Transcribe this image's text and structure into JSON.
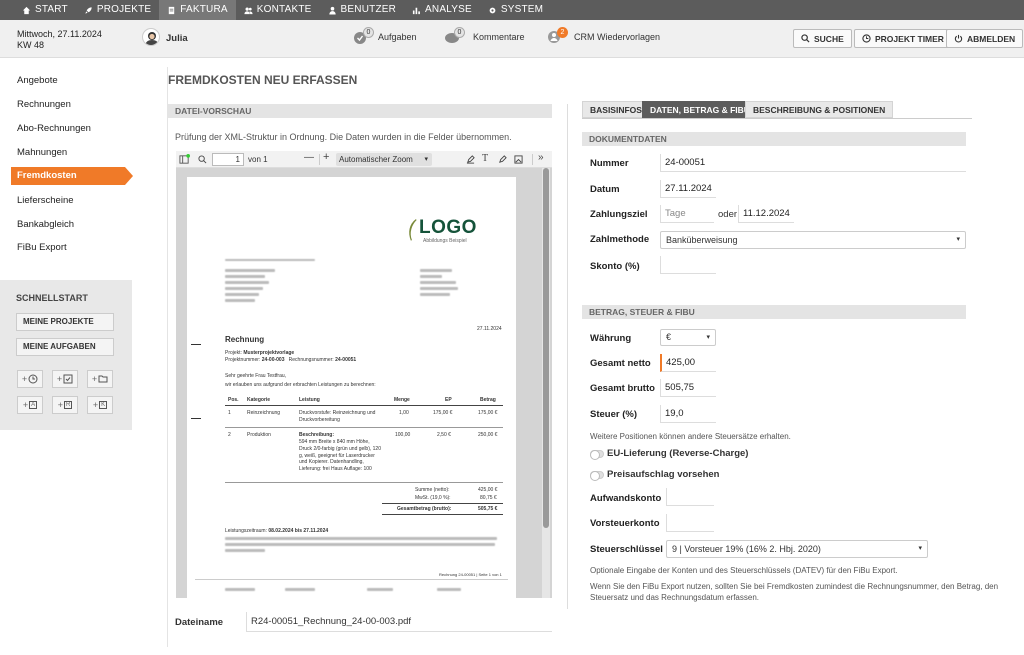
{
  "nav": {
    "items": [
      {
        "label": "START"
      },
      {
        "label": "PROJEKTE"
      },
      {
        "label": "FAKTURA"
      },
      {
        "label": "KONTAKTE"
      },
      {
        "label": "BENUTZER"
      },
      {
        "label": "ANALYSE"
      },
      {
        "label": "SYSTEM"
      }
    ]
  },
  "header": {
    "date": "Mittwoch, 27.11.2024",
    "week": "KW 48",
    "user": "Julia",
    "tasks_count": "0",
    "tasks_label": "Aufgaben",
    "comments_count": "0",
    "comments_label": "Kommentare",
    "crm_count": "2",
    "crm_label": "CRM Wiedervorlagen",
    "search_label": "SUCHE",
    "timer_label": "PROJEKT TIMER",
    "logout_label": "ABMELDEN"
  },
  "sidebar": {
    "items": [
      {
        "label": "Angebote"
      },
      {
        "label": "Rechnungen"
      },
      {
        "label": "Abo-Rechnungen"
      },
      {
        "label": "Mahnungen"
      },
      {
        "label": "Fremdkosten"
      },
      {
        "label": "Lieferscheine"
      },
      {
        "label": "Bankabgleich"
      },
      {
        "label": "FiBu Export"
      }
    ],
    "quickstart_title": "SCHNELLSTART",
    "quick_buttons": [
      "MEINE PROJEKTE",
      "MEINE AUFGABEN"
    ],
    "quick_icons": [
      "A",
      "R",
      "K"
    ]
  },
  "page": {
    "title": "FREMDKOSTEN NEU ERFASSEN",
    "preview_title": "DATEI-VORSCHAU",
    "preview_msg": "Prüfung der XML-Struktur in Ordnung. Die Daten wurden in die Felder übernommen.",
    "filename_label": "Dateiname",
    "filename": "R24-00051_Rechnung_24-00-003.pdf"
  },
  "pdf": {
    "page_num": "1",
    "page_of": "von 1",
    "zoom": "Automatischer Zoom",
    "logo": "LOGO",
    "logo_sub": "Abbildungs Beispiel",
    "date": "27.11.2024",
    "heading": "Rechnung",
    "project_line": "Projekt:",
    "project": "Musterprojektvorlage",
    "projnr_label": "Projektnummer:",
    "projnr": "24-00-003",
    "rechnr_label": "Rechnungsnummer:",
    "rechnr": "24-00051",
    "greeting": "Sehr geehrte Frau Testfrau,",
    "intro": "wir erlauben uns aufgrund der erbrachten Leistungen zu berechnen:",
    "cols": [
      "Pos.",
      "Kategorie",
      "Leistung",
      "Menge",
      "EP",
      "Betrag"
    ],
    "rows": [
      {
        "pos": "1",
        "kat": "Reinzeichnung",
        "leist": "Druckvorstufe: Reinzeichnung und",
        "leist2": "Druckvorbereitung",
        "menge": "1,00",
        "ep": "175,00 €",
        "betrag": "175,00 €"
      },
      {
        "pos": "2",
        "kat": "Produktion",
        "leist": "Beschreibung:",
        "leist2": "594 mm Breite x 840 mm Höhe, Druck 2/0-farbig (grün und gelb), 120 g, weiß, geeignet für Laserdrucker und Kopierer. Datenhandling, Lieferung: frei Haus Auflage: 100",
        "menge": "100,00",
        "ep": "2,50 €",
        "betrag": "250,00 €"
      }
    ],
    "summe_label": "Summe (netto):",
    "summe": "425,00 €",
    "mwst_label": "MwSt. (19,0 %):",
    "mwst": "80,75 €",
    "gesamt_label": "Gesamtbetrag (brutto):",
    "gesamt": "505,75 €",
    "zeitraum_label": "Leistungszeitraum:",
    "zeitraum": "08.02.2024 bis 27.11.2024",
    "footer_page": "Rechnung 24-00051 | Seite 1 von 1"
  },
  "form": {
    "tabs": [
      "BASISINFOS",
      "DATEN, BETRAG & FIBU",
      "BESCHREIBUNG & POSITIONEN"
    ],
    "section1": "DOKUMENTDATEN",
    "nummer_label": "Nummer",
    "nummer": "24-00051",
    "datum_label": "Datum",
    "datum": "27.11.2024",
    "ziel_label": "Zahlungsziel",
    "ziel_placeholder": "Tage",
    "oder": "oder",
    "ziel_date": "11.12.2024",
    "methode_label": "Zahlmethode",
    "methode": "Banküberweisung",
    "skonto_label": "Skonto (%)",
    "section2": "BETRAG, STEUER & FIBU",
    "waehrung_label": "Währung",
    "waehrung": "€",
    "netto_label": "Gesamt netto",
    "netto": "425,00",
    "brutto_label": "Gesamt brutto",
    "brutto": "505,75",
    "steuer_label": "Steuer (%)",
    "steuer": "19,0",
    "steuer_note": "Weitere Positionen können andere Steuersätze erhalten.",
    "eu_label": "EU-Lieferung (Reverse-Charge)",
    "preis_label": "Preisaufschlag vorsehen",
    "aufwand_label": "Aufwandskonto",
    "vorsteuer_label": "Vorsteuerkonto",
    "schluessel_label": "Steuerschlüssel",
    "schluessel": "9 | Vorsteuer 19% (16% 2. Hbj. 2020)",
    "note1": "Optionale Eingabe der Konten und des Steuerschlüssels (DATEV) für den FiBu Export.",
    "note2": "Wenn Sie den FiBu Export nutzen, sollten Sie bei Fremdkosten zumindest die Rechnungsnummer, den Betrag, den",
    "note3": "Steuersatz und das Rechnungsdatum erfassen."
  }
}
